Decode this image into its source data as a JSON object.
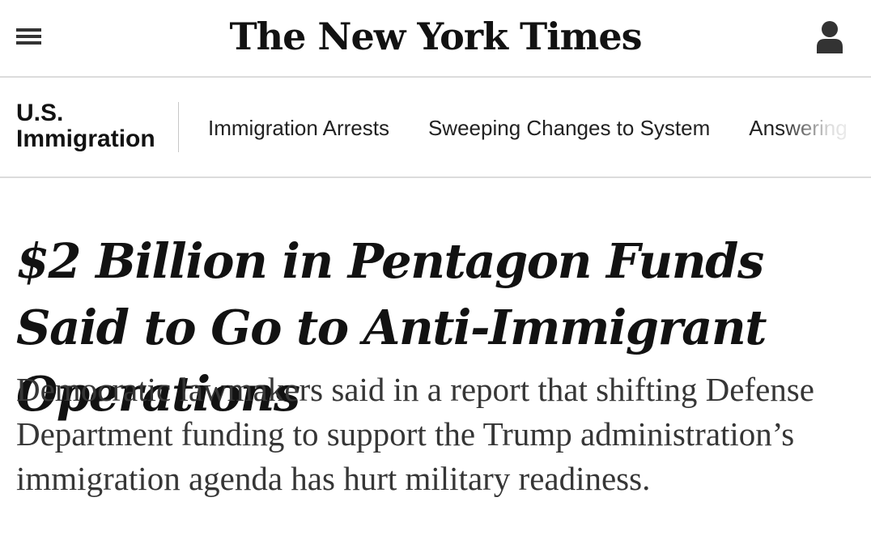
{
  "masthead": {
    "logo_text": "The New York Times",
    "menu_icon": "hamburger-menu-icon",
    "account_icon": "user-account-icon"
  },
  "section": {
    "title_line1": "U.S.",
    "title_line2": "Immigration",
    "nav_items": [
      "Immigration Arrests",
      "Sweeping Changes to System",
      "Answering"
    ]
  },
  "article": {
    "headline": "$2 Billion in Pentagon Funds Said to Go to Anti-Immigrant Operations",
    "summary": "Democratic lawmakers said in a report that shifting Defense Department funding to support the Trump administration’s immigration agenda has hurt military readiness."
  },
  "colors": {
    "text": "#121212",
    "summary_text": "#363636",
    "divider": "#dcdcdc",
    "background": "#ffffff"
  }
}
